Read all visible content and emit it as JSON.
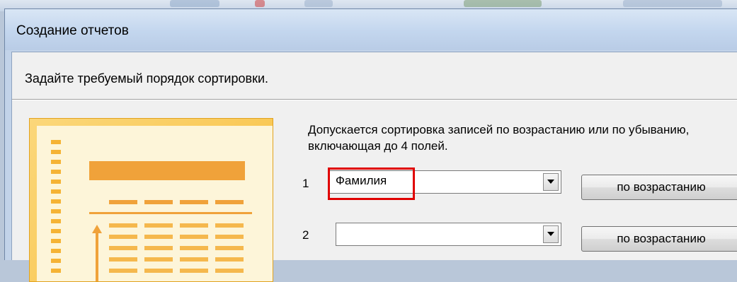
{
  "window": {
    "title": "Создание отчетов"
  },
  "wizard": {
    "heading": "Задайте требуемый порядок сортировки.",
    "description": "Допускается сортировка записей по возрастанию или по убыванию, включающая до 4 полей."
  },
  "sort_rows": [
    {
      "number": "1",
      "field": "Фамилия",
      "order": "по возрастанию"
    },
    {
      "number": "2",
      "field": "",
      "order": "по возрастанию"
    }
  ],
  "colors": {
    "highlight": "#e00000",
    "preview_accent": "#f5a623"
  }
}
